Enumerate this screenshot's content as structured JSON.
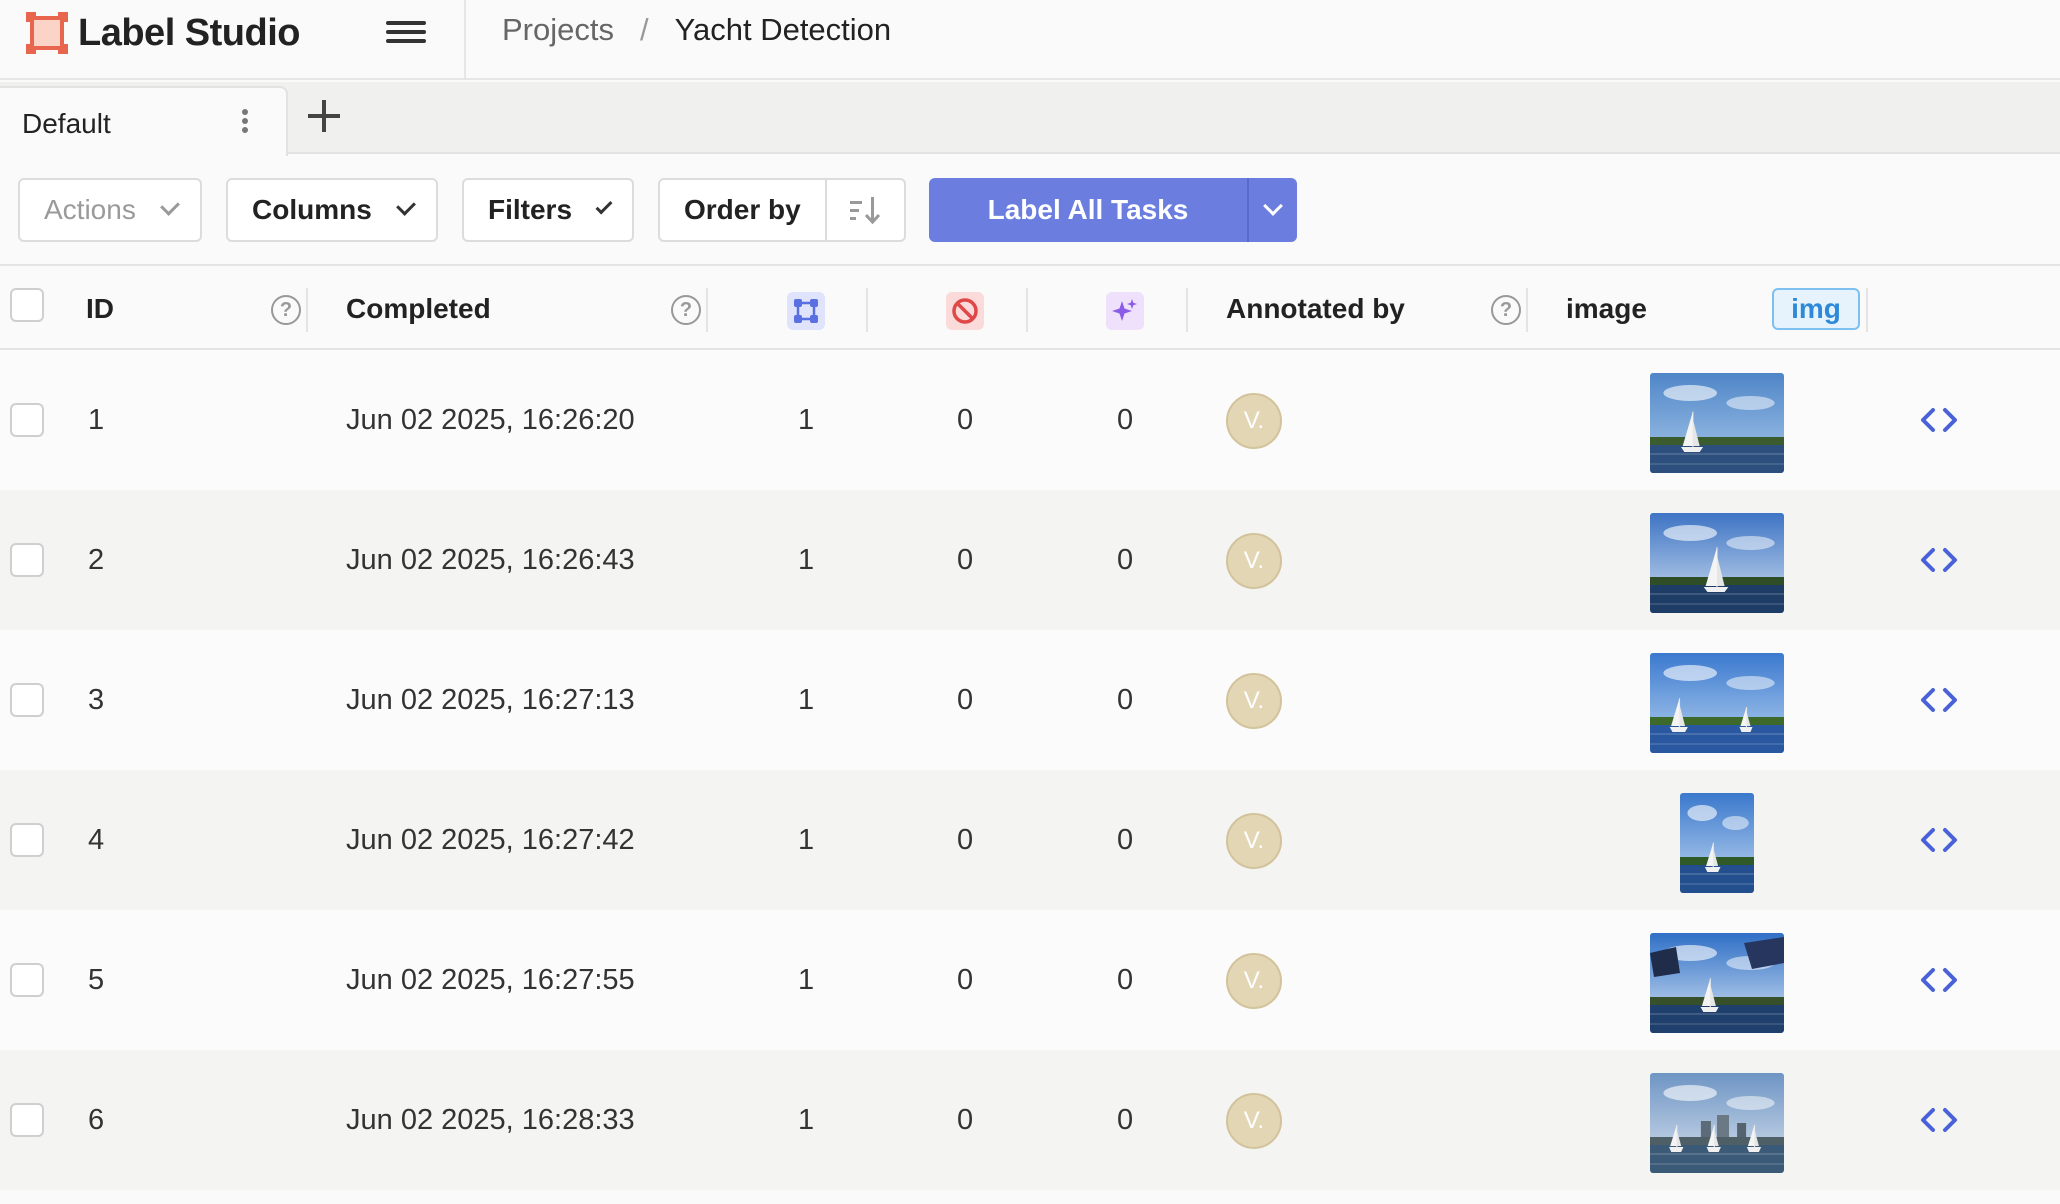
{
  "app": {
    "name": "Label Studio"
  },
  "breadcrumb": {
    "projects": "Projects",
    "separator": "/",
    "current": "Yacht Detection"
  },
  "tabs": [
    {
      "label": "Default"
    }
  ],
  "toolbar": {
    "actions_label": "Actions",
    "columns_label": "Columns",
    "filters_label": "Filters",
    "order_label": "Order by",
    "label_all_label": "Label All Tasks"
  },
  "table": {
    "headers": {
      "id": "ID",
      "completed": "Completed",
      "annotated_by": "Annotated by",
      "image": "image",
      "image_tag": "img",
      "help": "?"
    },
    "column_icons": [
      "annotations-icon",
      "cancelled-icon",
      "predictions-icon"
    ],
    "rows": [
      {
        "id": "1",
        "completed": "Jun 02 2025, 16:26:20",
        "annotations": "1",
        "cancelled": "0",
        "predictions": "0",
        "annotator": "V."
      },
      {
        "id": "2",
        "completed": "Jun 02 2025, 16:26:43",
        "annotations": "1",
        "cancelled": "0",
        "predictions": "0",
        "annotator": "V."
      },
      {
        "id": "3",
        "completed": "Jun 02 2025, 16:27:13",
        "annotations": "1",
        "cancelled": "0",
        "predictions": "0",
        "annotator": "V."
      },
      {
        "id": "4",
        "completed": "Jun 02 2025, 16:27:42",
        "annotations": "1",
        "cancelled": "0",
        "predictions": "0",
        "annotator": "V."
      },
      {
        "id": "5",
        "completed": "Jun 02 2025, 16:27:55",
        "annotations": "1",
        "cancelled": "0",
        "predictions": "0",
        "annotator": "V."
      },
      {
        "id": "6",
        "completed": "Jun 02 2025, 16:28:33",
        "annotations": "1",
        "cancelled": "0",
        "predictions": "0",
        "annotator": "V."
      }
    ]
  },
  "colors": {
    "brand": "#e8664d",
    "primary": "#6b7ee0",
    "avatar": "#e3d6b4",
    "tag": "#2e8ad8"
  }
}
